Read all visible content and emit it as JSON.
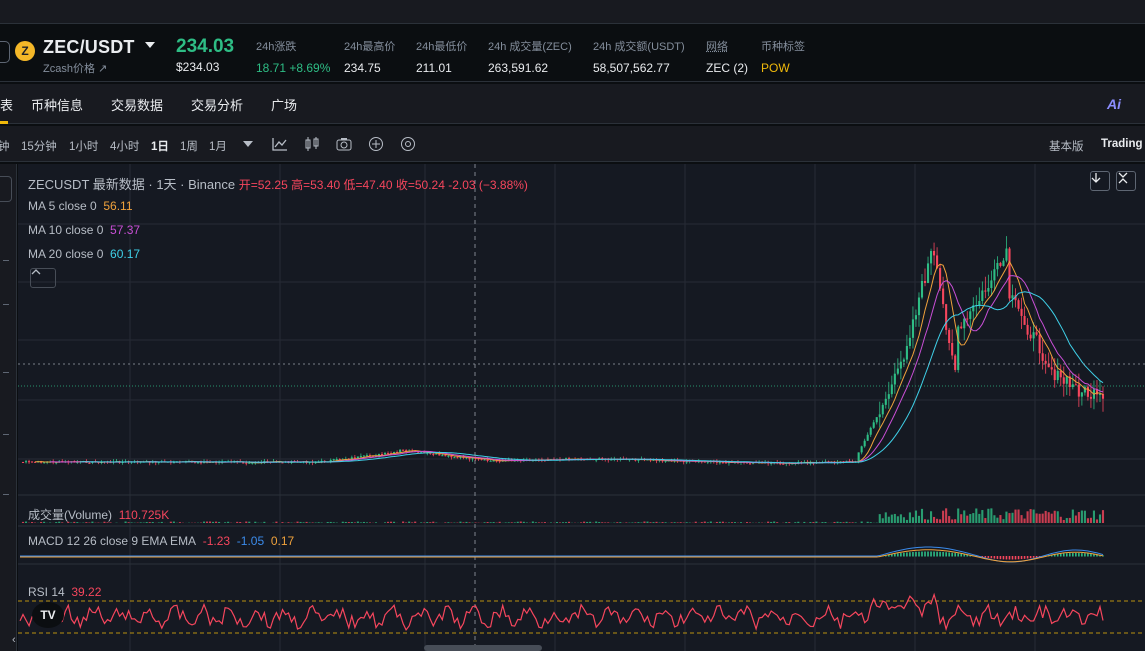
{
  "header": {
    "pair": "ZEC/USDT",
    "coin_glyph": "Z",
    "sub_name": "Zcash价格 ↗",
    "last_price": "234.03",
    "last_price_usd": "$234.03",
    "stats": [
      {
        "label": "24h涨跌",
        "value": "18.71 +8.69%",
        "color": "#2ebd85"
      },
      {
        "label": "24h最高价",
        "value": "234.75"
      },
      {
        "label": "24h最低价",
        "value": "211.01"
      },
      {
        "label": "24h 成交量(ZEC)",
        "value": "263,591.62"
      },
      {
        "label": "24h 成交额(USDT)",
        "value": "58,507,562.77"
      },
      {
        "label": "网络",
        "value": "ZEC (2)"
      },
      {
        "label": "币种标签",
        "value": "POW",
        "color": "#f0b90b"
      }
    ]
  },
  "tabs": {
    "active_cut": "表",
    "items": [
      "币种信息",
      "交易数据",
      "交易分析",
      "广场"
    ],
    "ai": "Ai"
  },
  "toolbar": {
    "timeframes": [
      "钟",
      "15分钟",
      "1小时",
      "4小时",
      "1日",
      "1周",
      "1月"
    ],
    "active_timeframe": "1日",
    "view_basic": "基本版",
    "view_tv": "Trading"
  },
  "chart": {
    "symbol_line": "ZECUSDT 最新数据 · 1天 · Binance",
    "ohlc": "开=52.25  高=53.40  低=47.40  收=50.24  -2.03 (−3.88%)",
    "ma": [
      {
        "label": "MA 5 close 0",
        "value": "56.11",
        "color": "#f0a23c"
      },
      {
        "label": "MA 10 close 0",
        "value": "57.37",
        "color": "#c94fd6"
      },
      {
        "label": "MA 20 close 0",
        "value": "60.17",
        "color": "#3fd0e8"
      }
    ],
    "volume_label": "成交量(Volume)",
    "volume_value": "110.725K",
    "macd_label": "MACD 12 26 close 9 EMA EMA",
    "macd_values": [
      {
        "v": "-1.23",
        "color": "#f6465d"
      },
      {
        "v": "-1.05",
        "color": "#3b8beb"
      },
      {
        "v": "0.17",
        "color": "#f0a23c"
      }
    ],
    "rsi_label": "RSI 14",
    "rsi_value": "39.22",
    "logo_text": "TV",
    "colors": {
      "up": "#2ebd85",
      "down": "#f6465d",
      "bg": "#151922",
      "grid": "#262b35"
    }
  }
}
